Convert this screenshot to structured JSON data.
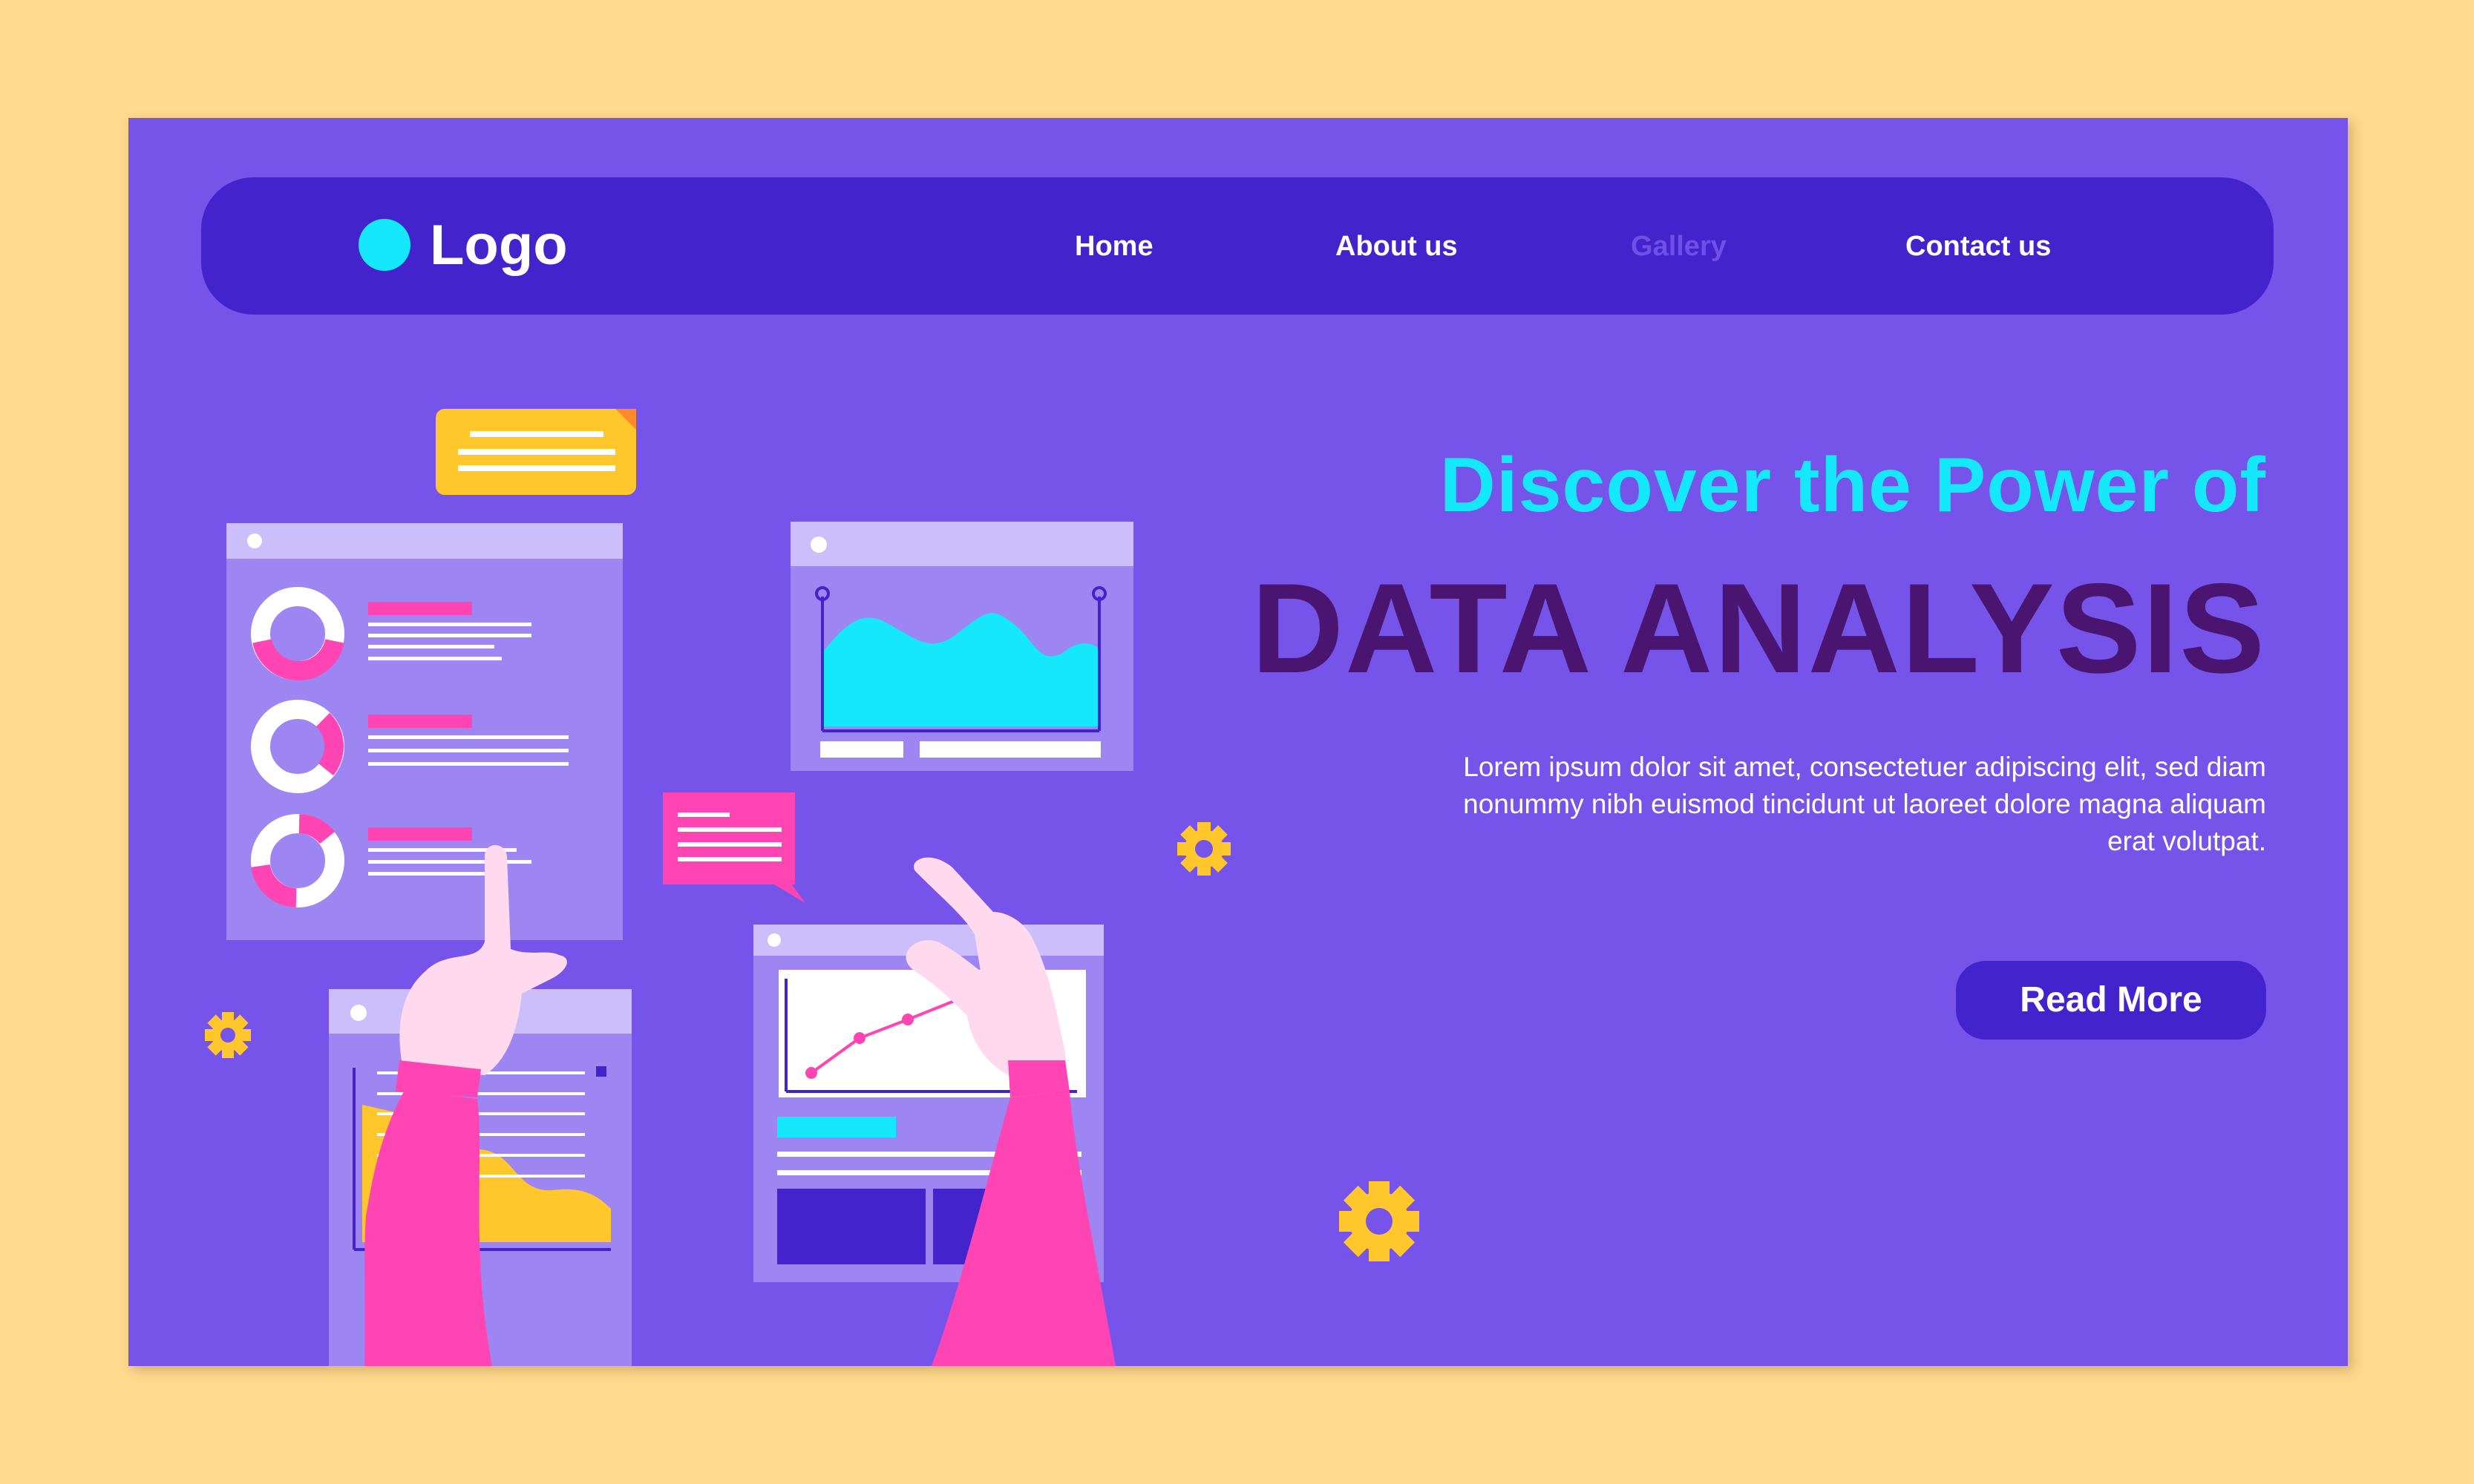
{
  "brand": {
    "logo_text": "Logo",
    "accent": "#14E8FA"
  },
  "nav": {
    "items": [
      {
        "label": "Home"
      },
      {
        "label": "About us"
      },
      {
        "label": "Gallery",
        "active": true
      },
      {
        "label": "Contact us"
      }
    ]
  },
  "hero": {
    "kicker": "Discover the Power of",
    "title": "DATA ANALYSIS",
    "description": "Lorem ipsum dolor sit amet, consectetuer adipiscing elit, sed diam nonummy nibh euismod tincidunt ut laoreet dolore magna aliquam erat volutpat.",
    "cta_label": "Read More"
  },
  "colors": {
    "page_bg": "#7654EA",
    "outer_bg": "#FED98E",
    "nav_bg": "#4323CC",
    "title": "#4A1570",
    "pink": "#FF44B4",
    "yellow": "#FFC72B",
    "cyan": "#14E8FA"
  },
  "illustration": {
    "icons": [
      "donut-chart-icon",
      "area-chart-icon",
      "line-chart-icon",
      "message-bubble-icon",
      "note-icon",
      "gear-icon",
      "pointing-hand-icon"
    ]
  }
}
